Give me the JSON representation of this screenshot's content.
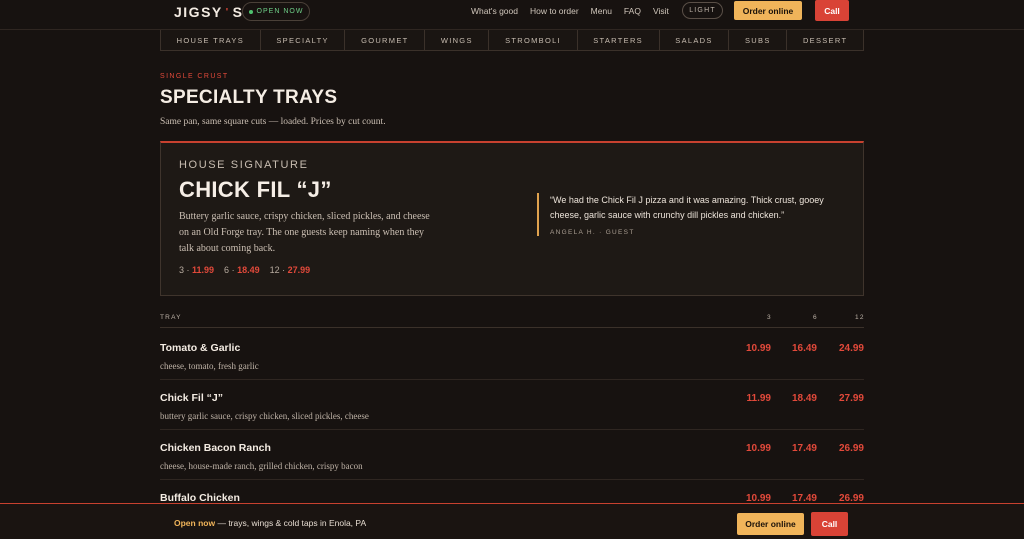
{
  "header": {
    "logo": "JIGSY",
    "logo_tick": "'",
    "logo_end": "S",
    "status": "OPEN NOW",
    "nav": [
      "What's good",
      "How to order",
      "Menu",
      "FAQ",
      "Visit"
    ],
    "theme_toggle": "LIGHT",
    "order_label": "Order online",
    "call_label": "Call"
  },
  "tabs": [
    "HOUSE TRAYS",
    "SPECIALTY",
    "GOURMET",
    "WINGS",
    "STROMBOLI",
    "STARTERS",
    "SALADS",
    "SUBS",
    "DESSERT"
  ],
  "section": {
    "eyebrow": "SINGLE CRUST",
    "title": "SPECIALTY TRAYS",
    "subtitle": "Same pan, same square cuts — loaded. Prices by cut count."
  },
  "feature": {
    "eyebrow": "HOUSE SIGNATURE",
    "title": "CHICK FIL “J”",
    "description": "Buttery garlic sauce, crispy chicken, sliced pickles, and cheese on an Old Forge tray. The one guests keep naming when they talk about coming back.",
    "prices": [
      {
        "count": "3",
        "price": "11.99"
      },
      {
        "count": "6",
        "price": "18.49"
      },
      {
        "count": "12",
        "price": "27.99"
      }
    ],
    "quote": "“We had the Chick Fil J pizza and it was amazing. Thick crust, gooey cheese, garlic sauce with crunchy dill pickles and chicken.”",
    "quote_author": "ANGELA H. · GUEST"
  },
  "table": {
    "headers": {
      "tray": "TRAY",
      "c3": "3",
      "c6": "6",
      "c12": "12"
    },
    "rows": [
      {
        "name": "Tomato & Garlic",
        "desc": "cheese, tomato, fresh garlic",
        "p3": "10.99",
        "p6": "16.49",
        "p12": "24.99"
      },
      {
        "name": "Chick Fil “J”",
        "desc": "buttery garlic sauce, crispy chicken, sliced pickles, cheese",
        "p3": "11.99",
        "p6": "18.49",
        "p12": "27.99"
      },
      {
        "name": "Chicken Bacon Ranch",
        "desc": "cheese, house-made ranch, grilled chicken, crispy bacon",
        "p3": "10.99",
        "p6": "17.49",
        "p12": "26.99"
      },
      {
        "name": "Buffalo Chicken",
        "desc": "",
        "p3": "10.99",
        "p6": "17.49",
        "p12": "26.99"
      }
    ]
  },
  "bottom_bar": {
    "open": "Open now",
    "text": " — trays, wings & cold taps in Enola, PA",
    "order_label": "Order online",
    "call_label": "Call"
  }
}
